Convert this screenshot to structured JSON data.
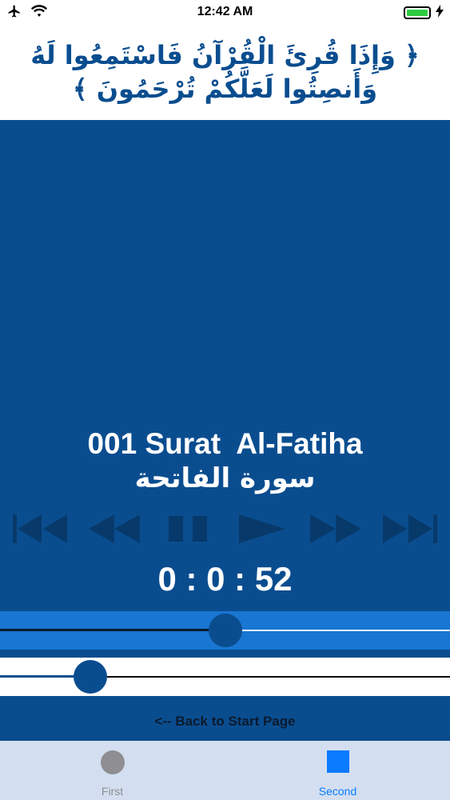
{
  "status_bar": {
    "time": "12:42 AM",
    "icons": [
      "airplane-icon",
      "wifi-icon",
      "battery-icon",
      "charging-bolt-icon"
    ]
  },
  "verse": {
    "line1": "﴿ وَإِذَا قُرِئَ الْقُرْآنُ فَاسْتَمِعُوا لَهُ",
    "line2": "وَأَنصِتُوا لَعَلَّكُمْ تُرْحَمُونَ ﴾"
  },
  "surah": {
    "title_en": "001 Surat  Al-Fatiha",
    "title_ar": "سورة الفاتحة"
  },
  "controls": {
    "icons": [
      "skip-to-start-icon",
      "rewind-icon",
      "pause-icon",
      "play-icon",
      "fast-forward-icon",
      "skip-to-end-icon"
    ]
  },
  "timer": {
    "display": "0 : 0 : 52"
  },
  "sliders": {
    "position_fraction": 0.5,
    "volume_fraction": 0.2
  },
  "back_link": {
    "label": "<-- Back to Start Page"
  },
  "tab_bar": {
    "tabs": [
      {
        "label": "First",
        "icon": "circle-icon",
        "color": "#8e8e93"
      },
      {
        "label": "Second",
        "icon": "square-icon",
        "color": "#0a7aff"
      }
    ]
  },
  "colors": {
    "background": "#0a4d8f",
    "accent_track": "#1976d2",
    "control_icons": "#073a6b"
  }
}
